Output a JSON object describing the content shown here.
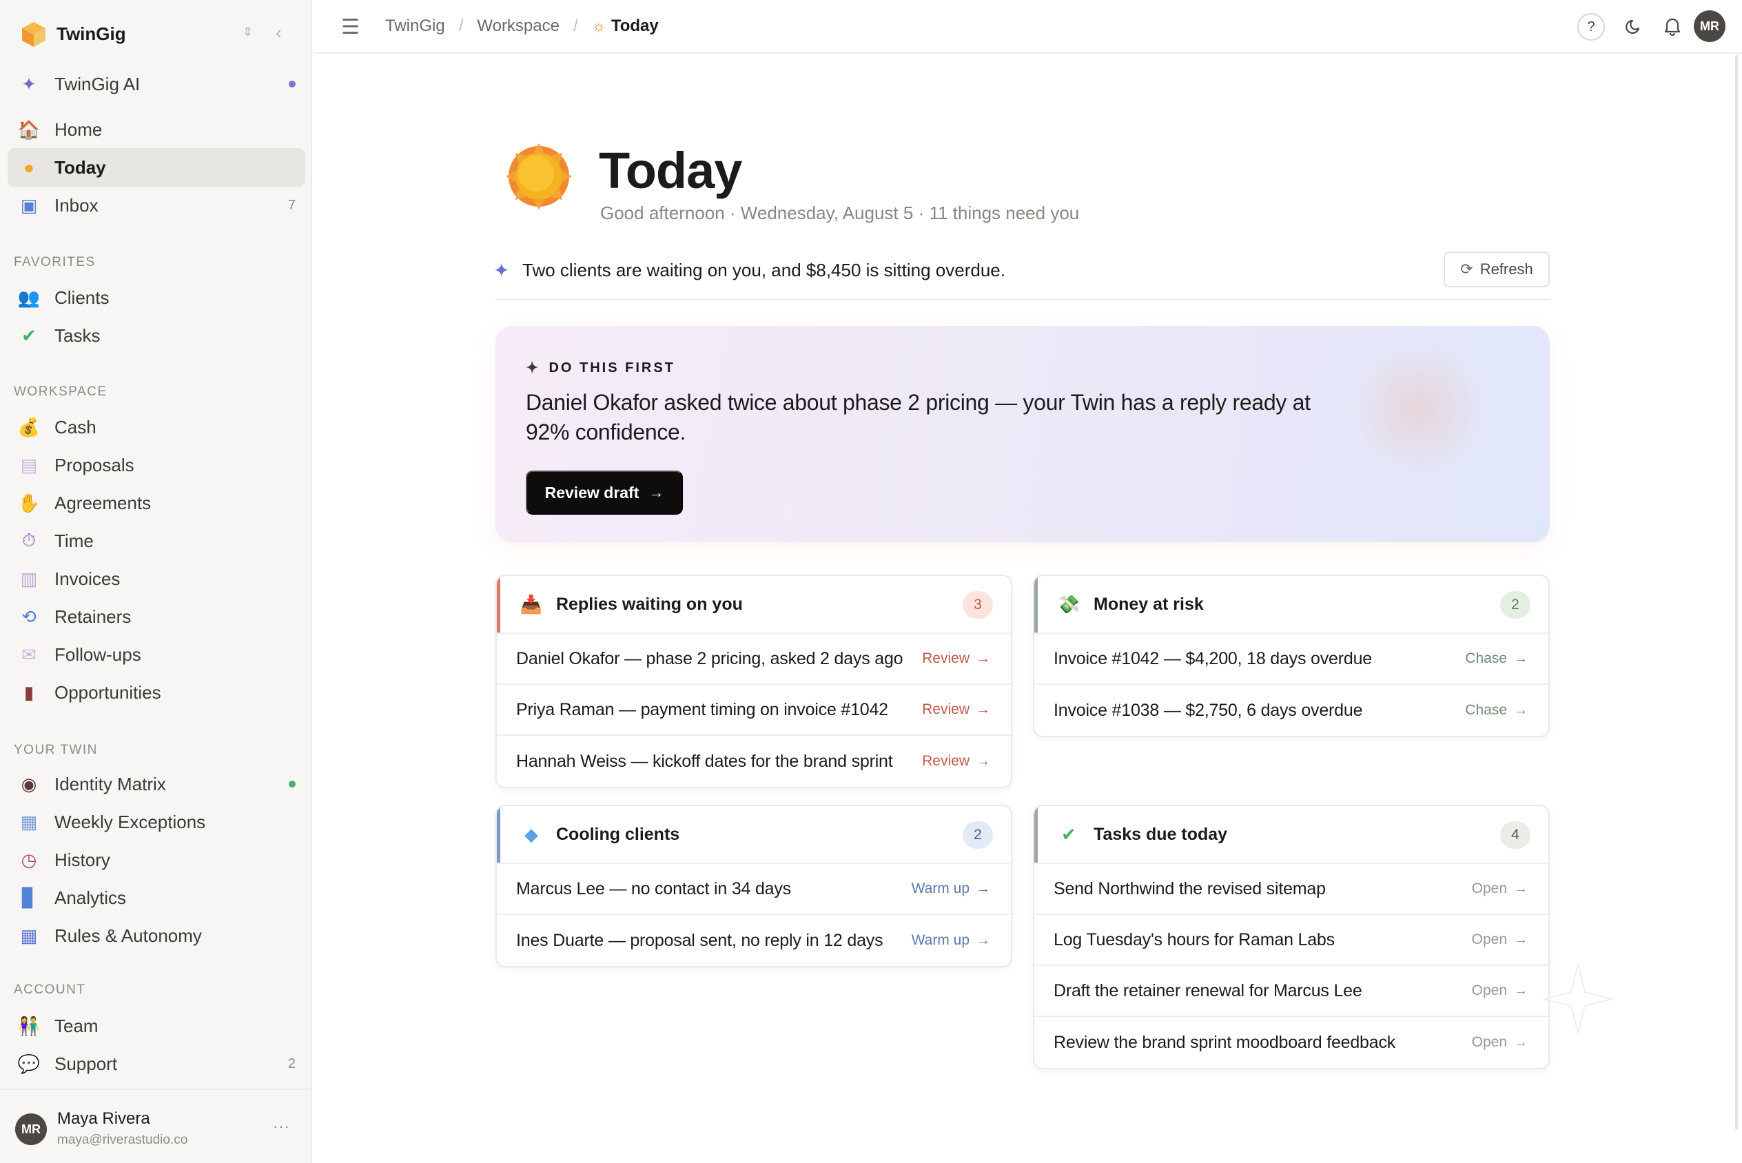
{
  "workspace": {
    "name": "TwinGig"
  },
  "sidebar": {
    "ai_item": {
      "label": "TwinGig AI"
    },
    "main_items": [
      {
        "label": "Home",
        "icon": "house-icon"
      },
      {
        "label": "Today",
        "icon": "sun-icon",
        "active": true
      },
      {
        "label": "Inbox",
        "icon": "inbox-icon",
        "count": "7"
      }
    ],
    "favorites_label": "FAVORITES",
    "favorites": [
      {
        "label": "Clients",
        "icon": "people-icon"
      },
      {
        "label": "Tasks",
        "icon": "checkbox-icon"
      }
    ],
    "workspace_label": "WORKSPACE",
    "workspace_items": [
      {
        "label": "Cash",
        "icon": "money-bag-icon"
      },
      {
        "label": "Proposals",
        "icon": "document-icon"
      },
      {
        "label": "Agreements",
        "icon": "handshake-icon"
      },
      {
        "label": "Time",
        "icon": "stopwatch-icon"
      },
      {
        "label": "Invoices",
        "icon": "receipt-icon"
      },
      {
        "label": "Retainers",
        "icon": "repeat-icon"
      },
      {
        "label": "Follow-ups",
        "icon": "envelope-icon"
      },
      {
        "label": "Opportunities",
        "icon": "briefcase-icon"
      }
    ],
    "twin_label": "YOUR TWIN",
    "twin_items": [
      {
        "label": "Identity Matrix",
        "icon": "identity-icon",
        "dot": true
      },
      {
        "label": "Weekly Exceptions",
        "icon": "calendar-icon"
      },
      {
        "label": "History",
        "icon": "clock-icon"
      },
      {
        "label": "Analytics",
        "icon": "bar-chart-icon"
      },
      {
        "label": "Rules & Autonomy",
        "icon": "grid-icon"
      }
    ],
    "account_label": "ACCOUNT",
    "account_items": [
      {
        "label": "Team",
        "icon": "team-icon"
      },
      {
        "label": "Support",
        "icon": "speech-bubble-icon",
        "count": "2"
      }
    ],
    "user": {
      "initials": "MR",
      "name": "Maya Rivera",
      "email": "maya@riverastudio.co"
    }
  },
  "topbar": {
    "breadcrumb": [
      "TwinGig",
      "Workspace",
      "Today"
    ],
    "help_label": "?",
    "avatar_initials": "MR"
  },
  "page": {
    "title": "Today",
    "subtitle": "Good afternoon · Wednesday, August 5 · 11 things need you",
    "summary": "Two clients are waiting on you, and $8,450 is sitting overdue.",
    "refresh_label": "Refresh"
  },
  "focus": {
    "kicker": "DO THIS FIRST",
    "body": "Daniel Okafor asked twice about phase 2 pricing — your Twin has a reply ready at 92% confidence.",
    "button_label": "Review draft"
  },
  "panels": {
    "replies": {
      "title": "Replies waiting on you",
      "count": "3",
      "accent": "#d97a6a",
      "action_color": "#c0574a",
      "rows": [
        {
          "text": "Daniel Okafor — phase 2 pricing, asked 2 days ago",
          "action": "Review"
        },
        {
          "text": "Priya Raman — payment timing on invoice #1042",
          "action": "Review"
        },
        {
          "text": "Hannah Weiss — kickoff dates for the brand sprint",
          "action": "Review"
        }
      ]
    },
    "money": {
      "title": "Money at risk",
      "count": "2",
      "accent": "#9aa79a",
      "action_color": "#6f8a72",
      "rows": [
        {
          "text": "Invoice #1042 — $4,200, 18 days overdue",
          "action": "Chase"
        },
        {
          "text": "Invoice #1038 — $2,750, 6 days overdue",
          "action": "Chase"
        }
      ]
    },
    "cooling": {
      "title": "Cooling clients",
      "count": "2",
      "accent": "#7d98c6",
      "action_color": "#5b78b0",
      "rows": [
        {
          "text": "Marcus Lee — no contact in 34 days",
          "action": "Warm up"
        },
        {
          "text": "Ines Duarte — proposal sent, no reply in 12 days",
          "action": "Warm up"
        }
      ]
    },
    "tasks": {
      "title": "Tasks due today",
      "count": "4",
      "accent": "#a7a4a0",
      "action_color": "#9b9792",
      "rows": [
        {
          "text": "Send Northwind the revised sitemap",
          "action": "Open"
        },
        {
          "text": "Log Tuesday's hours for Raman Labs",
          "action": "Open"
        },
        {
          "text": "Draft the retainer renewal for Marcus Lee",
          "action": "Open"
        },
        {
          "text": "Review the brand sprint moodboard feedback",
          "action": "Open"
        }
      ]
    }
  }
}
